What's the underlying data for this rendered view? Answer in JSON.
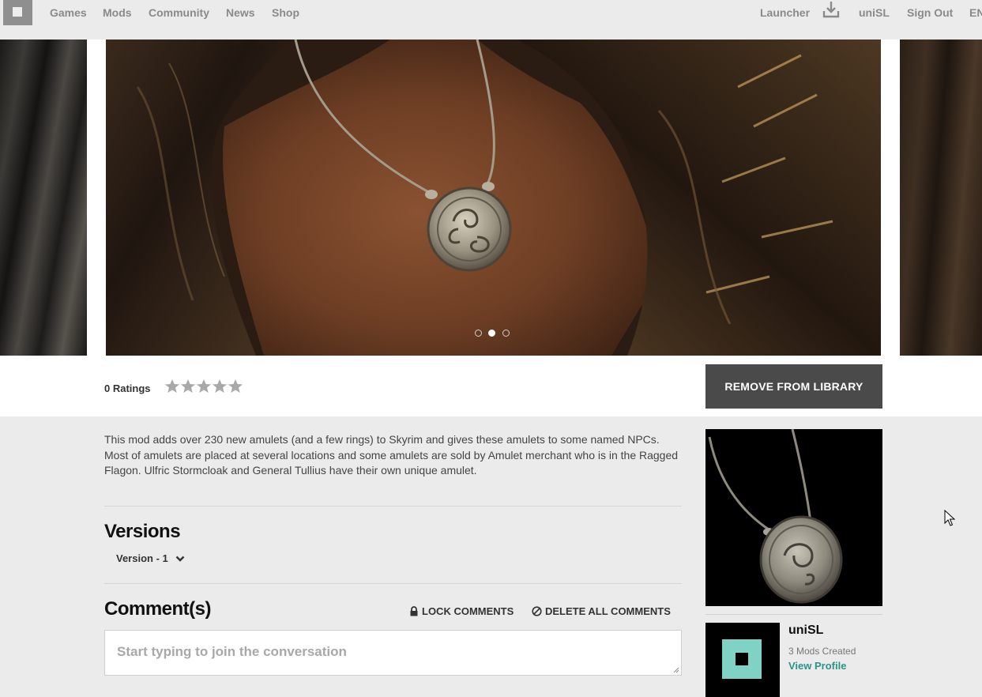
{
  "nav": {
    "left_links": [
      "Games",
      "Mods",
      "Community",
      "News",
      "Shop"
    ],
    "launcher": "Launcher",
    "download_icon": "download-icon",
    "username": "uniSL",
    "sign_out": "Sign Out",
    "language": "EN"
  },
  "carousel": {
    "slide_count": 3,
    "active_slide": 2,
    "main_image": "amulet-on-chest-screenshot"
  },
  "rating": {
    "label": "0 Ratings",
    "stars_filled": 0,
    "stars_total": 5
  },
  "actions": {
    "remove_from_library": "REMOVE FROM LIBRARY"
  },
  "description": "This mod adds over 230 new amulets (and a few rings) to Skyrim and gives these amulets to some named NPCs. Most of amulets are placed at several locations and some amulets are sold by Amulet merchant who is in the Ragged Flagon. Ulfric Stormcloak and General Tullius have their own unique amulet.",
  "versions": {
    "title": "Versions",
    "selected": "Version - 1"
  },
  "comments": {
    "title": "Comment(s)",
    "lock_label": "LOCK COMMENTS",
    "delete_label": "DELETE ALL COMMENTS",
    "placeholder": "Start typing to join the conversation",
    "value": ""
  },
  "author": {
    "name": "uniSL",
    "mods_created": "3 Mods Created",
    "view_profile": "View Profile"
  },
  "colors": {
    "nav_bg": "#ebebeb",
    "nav_text": "#8a8a8a",
    "button_dark": "#4a4a4a",
    "link_teal": "#2a9486",
    "avatar_teal": "#7fd2c4",
    "star_gray": "#a9a9a9"
  }
}
